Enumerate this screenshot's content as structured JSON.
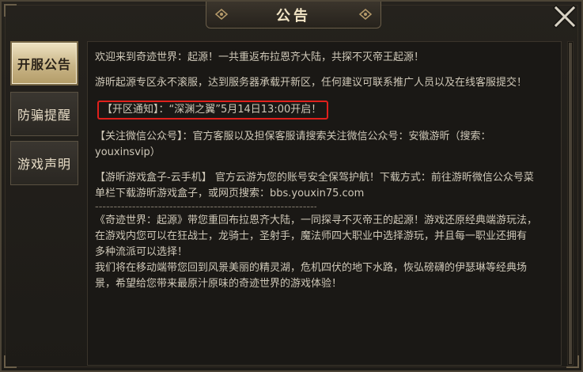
{
  "window": {
    "title": "公告",
    "close_icon": "close-x-icon"
  },
  "tabs": [
    {
      "label": "开服公告",
      "active": true
    },
    {
      "label": "防骗提醒",
      "active": false
    },
    {
      "label": "游戏声明",
      "active": false
    }
  ],
  "content": {
    "p1": "欢迎来到奇迹世界：起源！一共重返布拉恩齐大陆，共探不灭帝王起源！",
    "p2": "游昕起源专区永不滚服，达到服务器承载开新区，任何建议可联系推广人员以及在线客服提交！",
    "notice": "【开区通知】：“深渊之翼”5月14日13:00开启！",
    "p3a": "【关注微信公众号】：官方客服以及担保客服请搜索关注微信公众号：安徽游昕（搜索：",
    "p3b": "youxinsvip）",
    "p4a": "【游昕游戏盒子-云手机】 官方云游为您的账号安全保驾护航！下载方式：前往游昕微信公众号菜",
    "p4b": "单栏下载游昕游戏盒子，或网页搜索：bbs.youxin75.com",
    "divider": "----------------------------------------------------------------------------",
    "p5a": "《奇迹世界：起源》带您重回布拉恩齐大陆，一同探寻不灭帝王的起源！游戏还原经典端游玩法，",
    "p5b": "在游戏内您可以在狂战士，龙骑士，圣射手，魔法师四大职业中选择游玩，并且每一职业还拥有",
    "p5c": "多种流派可以选择！",
    "p6a": "我们将在移动端带您回到风景美丽的精灵湖，危机四伏的地下水路，恢弘磅礴的伊瑟琳等经典场",
    "p6b": "景，希望给您带来最原汁原味的奇迹世界的游戏体验！"
  },
  "colors": {
    "accent_gold": "#c9b587",
    "highlight_red": "#e0201c",
    "text": "#cfc8b8"
  }
}
